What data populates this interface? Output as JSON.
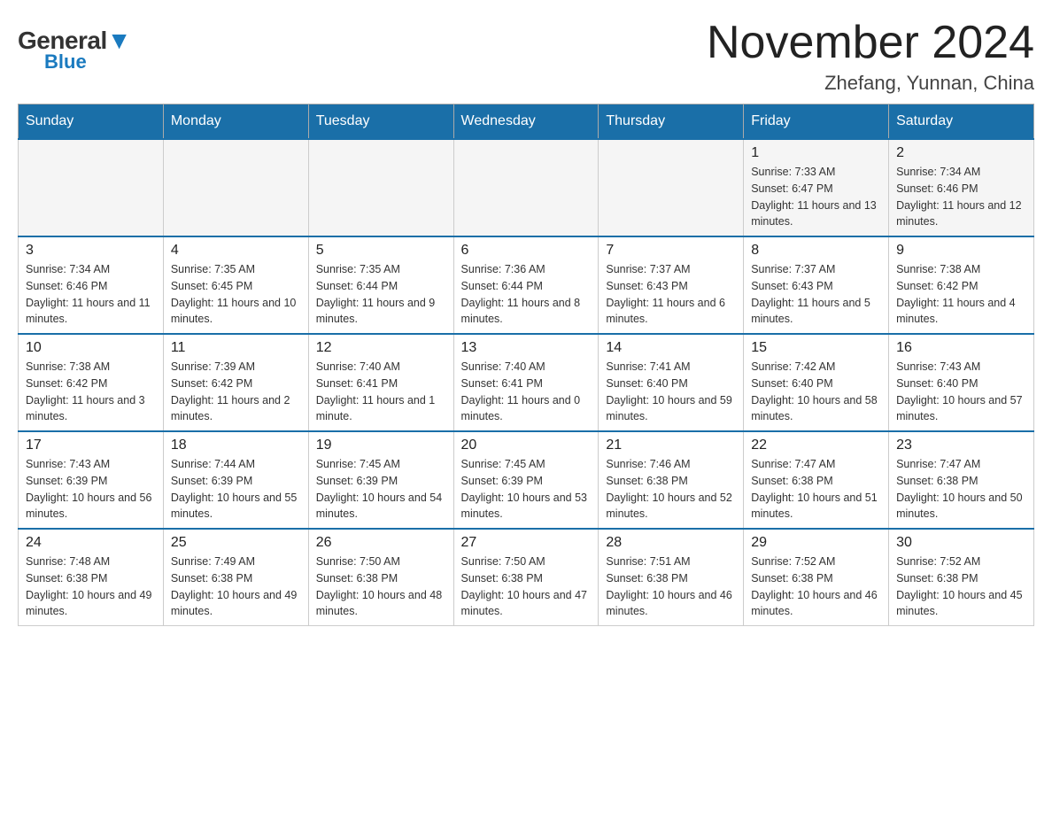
{
  "header": {
    "logo_general": "General",
    "logo_blue": "Blue",
    "title": "November 2024",
    "subtitle": "Zhefang, Yunnan, China"
  },
  "days_of_week": [
    "Sunday",
    "Monday",
    "Tuesday",
    "Wednesday",
    "Thursday",
    "Friday",
    "Saturday"
  ],
  "weeks": [
    [
      {
        "day": "",
        "sunrise": "",
        "sunset": "",
        "daylight": "",
        "empty": true
      },
      {
        "day": "",
        "sunrise": "",
        "sunset": "",
        "daylight": "",
        "empty": true
      },
      {
        "day": "",
        "sunrise": "",
        "sunset": "",
        "daylight": "",
        "empty": true
      },
      {
        "day": "",
        "sunrise": "",
        "sunset": "",
        "daylight": "",
        "empty": true
      },
      {
        "day": "",
        "sunrise": "",
        "sunset": "",
        "daylight": "",
        "empty": true
      },
      {
        "day": "1",
        "sunrise": "Sunrise: 7:33 AM",
        "sunset": "Sunset: 6:47 PM",
        "daylight": "Daylight: 11 hours and 13 minutes.",
        "empty": false
      },
      {
        "day": "2",
        "sunrise": "Sunrise: 7:34 AM",
        "sunset": "Sunset: 6:46 PM",
        "daylight": "Daylight: 11 hours and 12 minutes.",
        "empty": false
      }
    ],
    [
      {
        "day": "3",
        "sunrise": "Sunrise: 7:34 AM",
        "sunset": "Sunset: 6:46 PM",
        "daylight": "Daylight: 11 hours and 11 minutes.",
        "empty": false
      },
      {
        "day": "4",
        "sunrise": "Sunrise: 7:35 AM",
        "sunset": "Sunset: 6:45 PM",
        "daylight": "Daylight: 11 hours and 10 minutes.",
        "empty": false
      },
      {
        "day": "5",
        "sunrise": "Sunrise: 7:35 AM",
        "sunset": "Sunset: 6:44 PM",
        "daylight": "Daylight: 11 hours and 9 minutes.",
        "empty": false
      },
      {
        "day": "6",
        "sunrise": "Sunrise: 7:36 AM",
        "sunset": "Sunset: 6:44 PM",
        "daylight": "Daylight: 11 hours and 8 minutes.",
        "empty": false
      },
      {
        "day": "7",
        "sunrise": "Sunrise: 7:37 AM",
        "sunset": "Sunset: 6:43 PM",
        "daylight": "Daylight: 11 hours and 6 minutes.",
        "empty": false
      },
      {
        "day": "8",
        "sunrise": "Sunrise: 7:37 AM",
        "sunset": "Sunset: 6:43 PM",
        "daylight": "Daylight: 11 hours and 5 minutes.",
        "empty": false
      },
      {
        "day": "9",
        "sunrise": "Sunrise: 7:38 AM",
        "sunset": "Sunset: 6:42 PM",
        "daylight": "Daylight: 11 hours and 4 minutes.",
        "empty": false
      }
    ],
    [
      {
        "day": "10",
        "sunrise": "Sunrise: 7:38 AM",
        "sunset": "Sunset: 6:42 PM",
        "daylight": "Daylight: 11 hours and 3 minutes.",
        "empty": false
      },
      {
        "day": "11",
        "sunrise": "Sunrise: 7:39 AM",
        "sunset": "Sunset: 6:42 PM",
        "daylight": "Daylight: 11 hours and 2 minutes.",
        "empty": false
      },
      {
        "day": "12",
        "sunrise": "Sunrise: 7:40 AM",
        "sunset": "Sunset: 6:41 PM",
        "daylight": "Daylight: 11 hours and 1 minute.",
        "empty": false
      },
      {
        "day": "13",
        "sunrise": "Sunrise: 7:40 AM",
        "sunset": "Sunset: 6:41 PM",
        "daylight": "Daylight: 11 hours and 0 minutes.",
        "empty": false
      },
      {
        "day": "14",
        "sunrise": "Sunrise: 7:41 AM",
        "sunset": "Sunset: 6:40 PM",
        "daylight": "Daylight: 10 hours and 59 minutes.",
        "empty": false
      },
      {
        "day": "15",
        "sunrise": "Sunrise: 7:42 AM",
        "sunset": "Sunset: 6:40 PM",
        "daylight": "Daylight: 10 hours and 58 minutes.",
        "empty": false
      },
      {
        "day": "16",
        "sunrise": "Sunrise: 7:43 AM",
        "sunset": "Sunset: 6:40 PM",
        "daylight": "Daylight: 10 hours and 57 minutes.",
        "empty": false
      }
    ],
    [
      {
        "day": "17",
        "sunrise": "Sunrise: 7:43 AM",
        "sunset": "Sunset: 6:39 PM",
        "daylight": "Daylight: 10 hours and 56 minutes.",
        "empty": false
      },
      {
        "day": "18",
        "sunrise": "Sunrise: 7:44 AM",
        "sunset": "Sunset: 6:39 PM",
        "daylight": "Daylight: 10 hours and 55 minutes.",
        "empty": false
      },
      {
        "day": "19",
        "sunrise": "Sunrise: 7:45 AM",
        "sunset": "Sunset: 6:39 PM",
        "daylight": "Daylight: 10 hours and 54 minutes.",
        "empty": false
      },
      {
        "day": "20",
        "sunrise": "Sunrise: 7:45 AM",
        "sunset": "Sunset: 6:39 PM",
        "daylight": "Daylight: 10 hours and 53 minutes.",
        "empty": false
      },
      {
        "day": "21",
        "sunrise": "Sunrise: 7:46 AM",
        "sunset": "Sunset: 6:38 PM",
        "daylight": "Daylight: 10 hours and 52 minutes.",
        "empty": false
      },
      {
        "day": "22",
        "sunrise": "Sunrise: 7:47 AM",
        "sunset": "Sunset: 6:38 PM",
        "daylight": "Daylight: 10 hours and 51 minutes.",
        "empty": false
      },
      {
        "day": "23",
        "sunrise": "Sunrise: 7:47 AM",
        "sunset": "Sunset: 6:38 PM",
        "daylight": "Daylight: 10 hours and 50 minutes.",
        "empty": false
      }
    ],
    [
      {
        "day": "24",
        "sunrise": "Sunrise: 7:48 AM",
        "sunset": "Sunset: 6:38 PM",
        "daylight": "Daylight: 10 hours and 49 minutes.",
        "empty": false
      },
      {
        "day": "25",
        "sunrise": "Sunrise: 7:49 AM",
        "sunset": "Sunset: 6:38 PM",
        "daylight": "Daylight: 10 hours and 49 minutes.",
        "empty": false
      },
      {
        "day": "26",
        "sunrise": "Sunrise: 7:50 AM",
        "sunset": "Sunset: 6:38 PM",
        "daylight": "Daylight: 10 hours and 48 minutes.",
        "empty": false
      },
      {
        "day": "27",
        "sunrise": "Sunrise: 7:50 AM",
        "sunset": "Sunset: 6:38 PM",
        "daylight": "Daylight: 10 hours and 47 minutes.",
        "empty": false
      },
      {
        "day": "28",
        "sunrise": "Sunrise: 7:51 AM",
        "sunset": "Sunset: 6:38 PM",
        "daylight": "Daylight: 10 hours and 46 minutes.",
        "empty": false
      },
      {
        "day": "29",
        "sunrise": "Sunrise: 7:52 AM",
        "sunset": "Sunset: 6:38 PM",
        "daylight": "Daylight: 10 hours and 46 minutes.",
        "empty": false
      },
      {
        "day": "30",
        "sunrise": "Sunrise: 7:52 AM",
        "sunset": "Sunset: 6:38 PM",
        "daylight": "Daylight: 10 hours and 45 minutes.",
        "empty": false
      }
    ]
  ]
}
